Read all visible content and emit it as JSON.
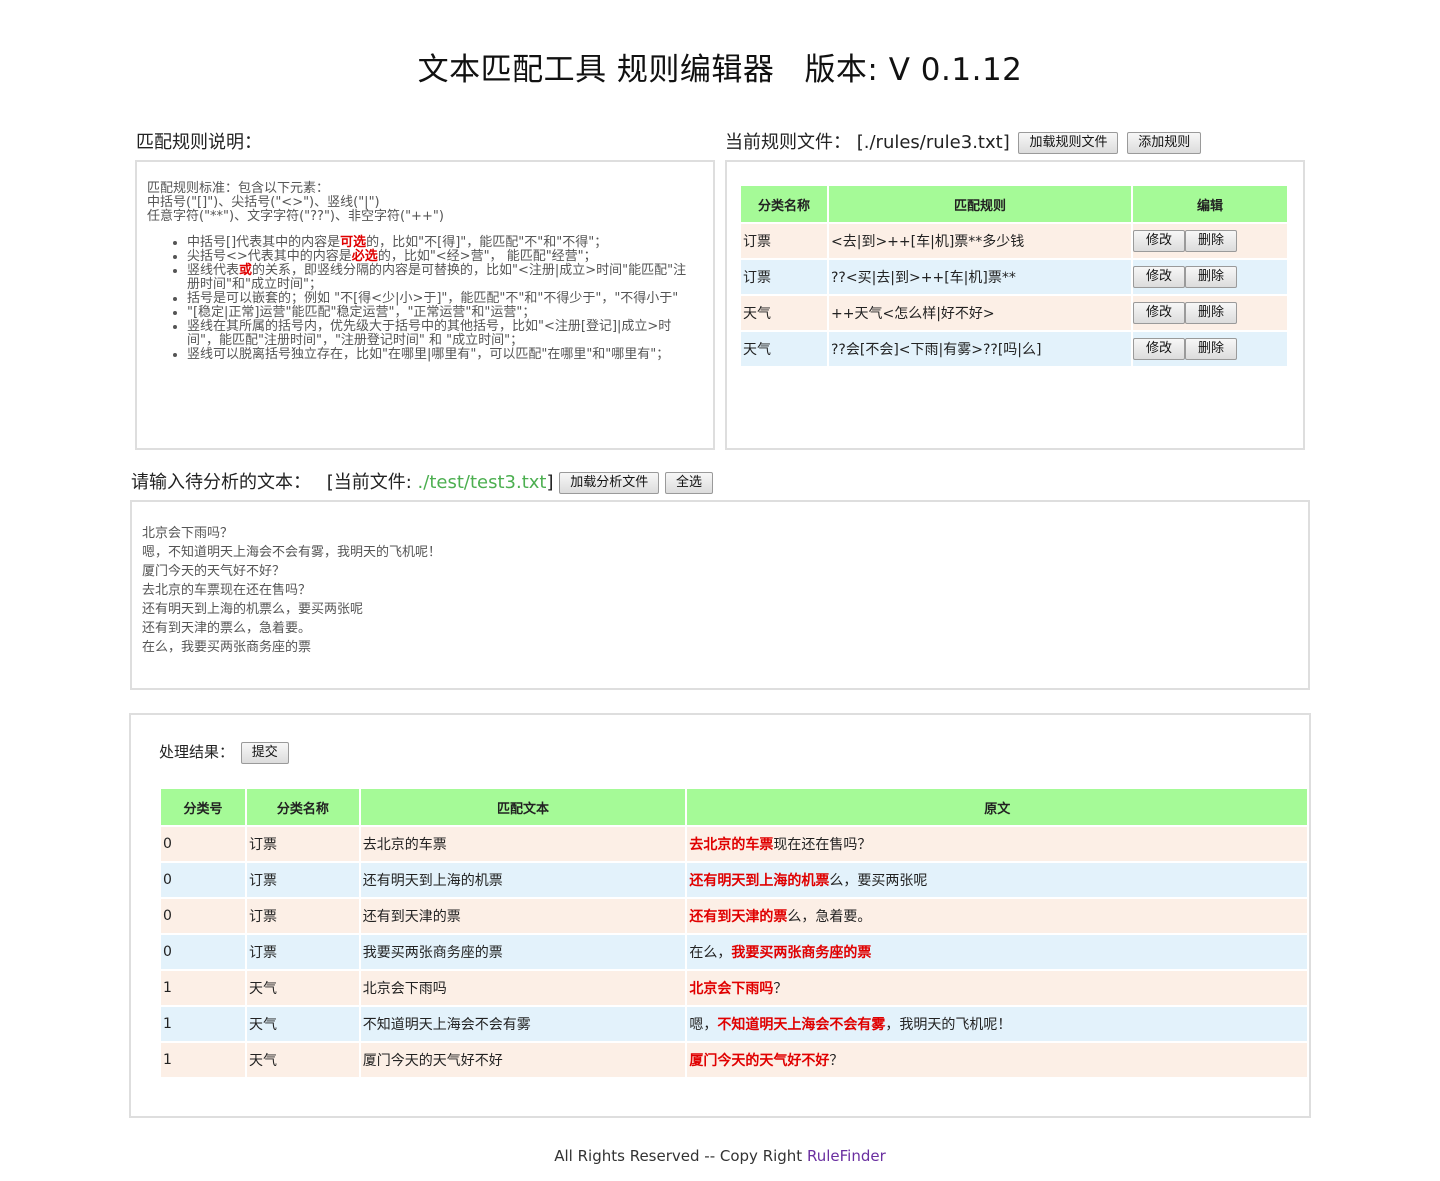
{
  "header": {
    "title": "文本匹配工具 规则编辑器",
    "version": "版本: V 0.1.12"
  },
  "rules_help": {
    "label": "匹配规则说明：",
    "standard_lines": [
      "匹配规则标准：包含以下元素：",
      "中括号(\"[]\")、尖括号(\"<>\")、竖线(\"|\")",
      "任意字符(\"**\")、文字字符(\"??\")、非空字符(\"++\")"
    ],
    "items": [
      {
        "pre": "中括号[]代表其中的内容是",
        "em": "可选",
        "post": "的，比如\"不[得]\"，能匹配\"不\"和\"不得\"；"
      },
      {
        "pre": "尖括号<>代表其中的内容是",
        "em": "必选",
        "post": "的，比如\"<经>营\"， 能匹配\"经营\"；"
      },
      {
        "pre": "竖线代表",
        "em": "或",
        "post": "的关系，即竖线分隔的内容是可替换的，比如\"<注册|成立>时间\"能匹配\"注册时间\"和\"成立时间\"；"
      },
      {
        "pre": "括号是可以嵌套的；例如 \"不[得<少|小>于]\"，能匹配\"不\"和\"不得少于\"，\"不得小于\"",
        "em": "",
        "post": ""
      },
      {
        "pre": "\"[稳定|正常]运营\"能匹配\"稳定运营\"，\"正常运营\"和\"运营\"；",
        "em": "",
        "post": ""
      },
      {
        "pre": "竖线在其所属的括号内，优先级大于括号中的其他括号，比如\"<注册[登记]|成立>时间\"，能匹配\"注册时间\"，\"注册登记时间\" 和 \"成立时间\"；",
        "em": "",
        "post": ""
      },
      {
        "pre": "竖线可以脱离括号独立存在，比如\"在哪里|哪里有\"，可以匹配\"在哪里\"和\"哪里有\"；",
        "em": "",
        "post": ""
      }
    ]
  },
  "rules_file": {
    "label": "当前规则文件：",
    "path": "[./rules/rule3.txt]",
    "load_button": "加载规则文件",
    "add_button": "添加规则",
    "columns": [
      "分类名称",
      "匹配规则",
      "编辑"
    ],
    "edit_label": "修改",
    "delete_label": "删除",
    "rows": [
      {
        "category": "订票",
        "rule": "<去|到>++[车|机]票**多少钱"
      },
      {
        "category": "订票",
        "rule": "??<买|去|到>++[车|机]票**"
      },
      {
        "category": "天气",
        "rule": "++天气<怎么样|好不好>"
      },
      {
        "category": "天气",
        "rule": "??会[不会]<下雨|有雾>??[吗|么]"
      }
    ]
  },
  "input": {
    "label": "请输入待分析的文本：",
    "current_prefix": "[当前文件: ",
    "file": "./test/test3.txt",
    "current_suffix": "]",
    "load_button": "加载分析文件",
    "select_all_button": "全选",
    "lines": [
      "北京会下雨吗？",
      "嗯，不知道明天上海会不会有雾，我明天的飞机呢！",
      "厦门今天的天气好不好？",
      "去北京的车票现在还在售吗？",
      "还有明天到上海的机票么，要买两张呢",
      "还有到天津的票么，急着要。",
      "在么，我要买两张商务座的票"
    ]
  },
  "results": {
    "label": "处理结果：",
    "submit_button": "提交",
    "columns": [
      "分类号",
      "分类名称",
      "匹配文本",
      "原文"
    ],
    "rows": [
      {
        "id": "0",
        "category": "订票",
        "match": "去北京的车票",
        "pre": "",
        "hit": "去北京的车票",
        "post": "现在还在售吗？"
      },
      {
        "id": "0",
        "category": "订票",
        "match": "还有明天到上海的机票",
        "pre": "",
        "hit": "还有明天到上海的机票",
        "post": "么，要买两张呢"
      },
      {
        "id": "0",
        "category": "订票",
        "match": "还有到天津的票",
        "pre": "",
        "hit": "还有到天津的票",
        "post": "么，急着要。"
      },
      {
        "id": "0",
        "category": "订票",
        "match": "我要买两张商务座的票",
        "pre": "在么，",
        "hit": "我要买两张商务座的票",
        "post": ""
      },
      {
        "id": "1",
        "category": "天气",
        "match": "北京会下雨吗",
        "pre": "",
        "hit": "北京会下雨吗",
        "post": "？"
      },
      {
        "id": "1",
        "category": "天气",
        "match": "不知道明天上海会不会有雾",
        "pre": "嗯，",
        "hit": "不知道明天上海会不会有雾",
        "post": "，我明天的飞机呢！"
      },
      {
        "id": "1",
        "category": "天气",
        "match": "厦门今天的天气好不好",
        "pre": "",
        "hit": "厦门今天的天气好不好",
        "post": "？"
      }
    ]
  },
  "footer": {
    "text": "All Rights Reserved -- Copy Right ",
    "brand": "RuleFinder"
  },
  "colors": {
    "header_green": "#a5fa97",
    "row_odd": "#fcefe6",
    "row_even": "#e3f2fb",
    "highlight_red": "#e00000",
    "file_green": "#4caf50",
    "brand_purple": "#6a2fa0"
  }
}
